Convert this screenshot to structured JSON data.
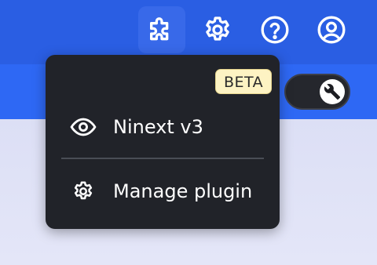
{
  "header": {
    "icons": [
      "puzzle-icon",
      "gear-icon",
      "help-icon",
      "user-icon"
    ]
  },
  "toggle": {
    "state": "on",
    "icon": "wrench-icon"
  },
  "menu": {
    "badge": "BETA",
    "items": [
      {
        "icon": "eye-icon",
        "label": "Ninext v3"
      },
      {
        "icon": "gear-icon",
        "label": "Manage plugin"
      }
    ]
  },
  "colors": {
    "header_bg": "#2a5ee3",
    "subbar_bg": "#2e68f4",
    "menu_bg": "#212329",
    "badge_bg": "#fdf3c3"
  }
}
